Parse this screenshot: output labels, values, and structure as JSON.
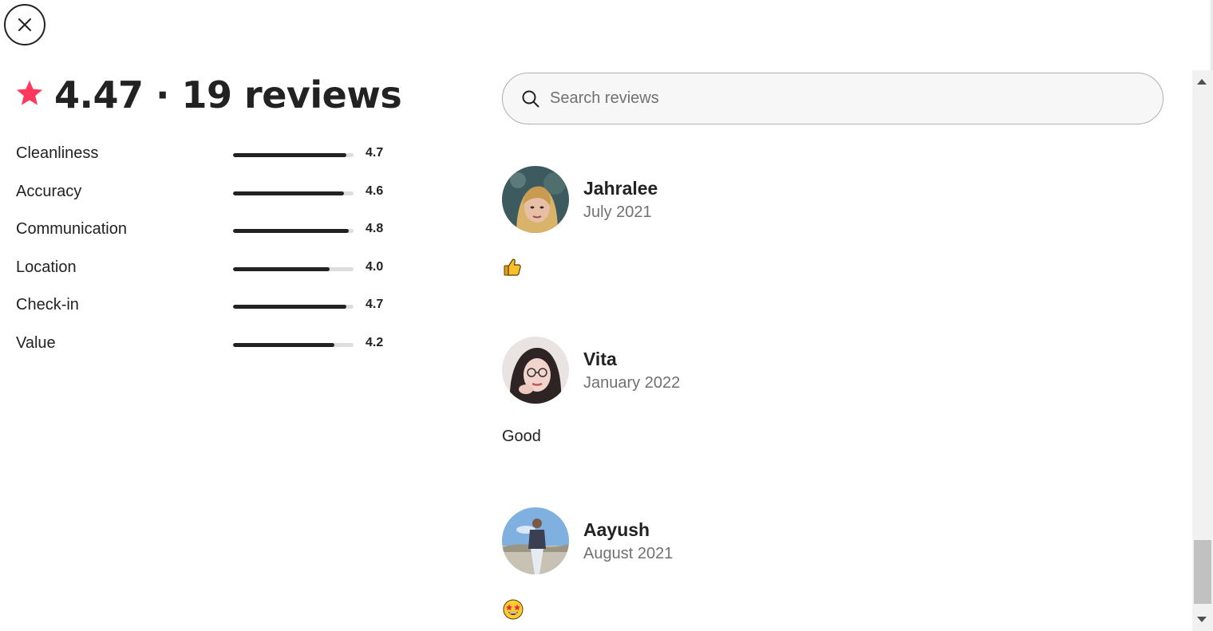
{
  "modal": {
    "close_icon": "close-icon"
  },
  "summary": {
    "star_icon": "star-icon",
    "star_color": "#ff385c",
    "heading": "4.47 · 19 reviews",
    "average": 4.47,
    "review_count": 19
  },
  "ratings": [
    {
      "label": "Cleanliness",
      "score": "4.7",
      "value": 4.7
    },
    {
      "label": "Accuracy",
      "score": "4.6",
      "value": 4.6
    },
    {
      "label": "Communication",
      "score": "4.8",
      "value": 4.8
    },
    {
      "label": "Location",
      "score": "4.0",
      "value": 4.0
    },
    {
      "label": "Check-in",
      "score": "4.7",
      "value": 4.7
    },
    {
      "label": "Value",
      "score": "4.2",
      "value": 4.2
    }
  ],
  "rating_scale_max": 5,
  "search": {
    "placeholder": "Search reviews",
    "icon": "search-icon"
  },
  "reviews": [
    {
      "name": "Jahralee",
      "date": "July 2021",
      "body_emoji": "👍"
    },
    {
      "name": "Vita",
      "date": "January 2022",
      "body": "Good"
    },
    {
      "name": "Aayush",
      "date": "August 2021",
      "body_emoji": "🤩"
    }
  ],
  "colors": {
    "text": "#222222",
    "muted": "#717171",
    "bar_fill": "#222222",
    "bar_track": "#dddddd"
  }
}
